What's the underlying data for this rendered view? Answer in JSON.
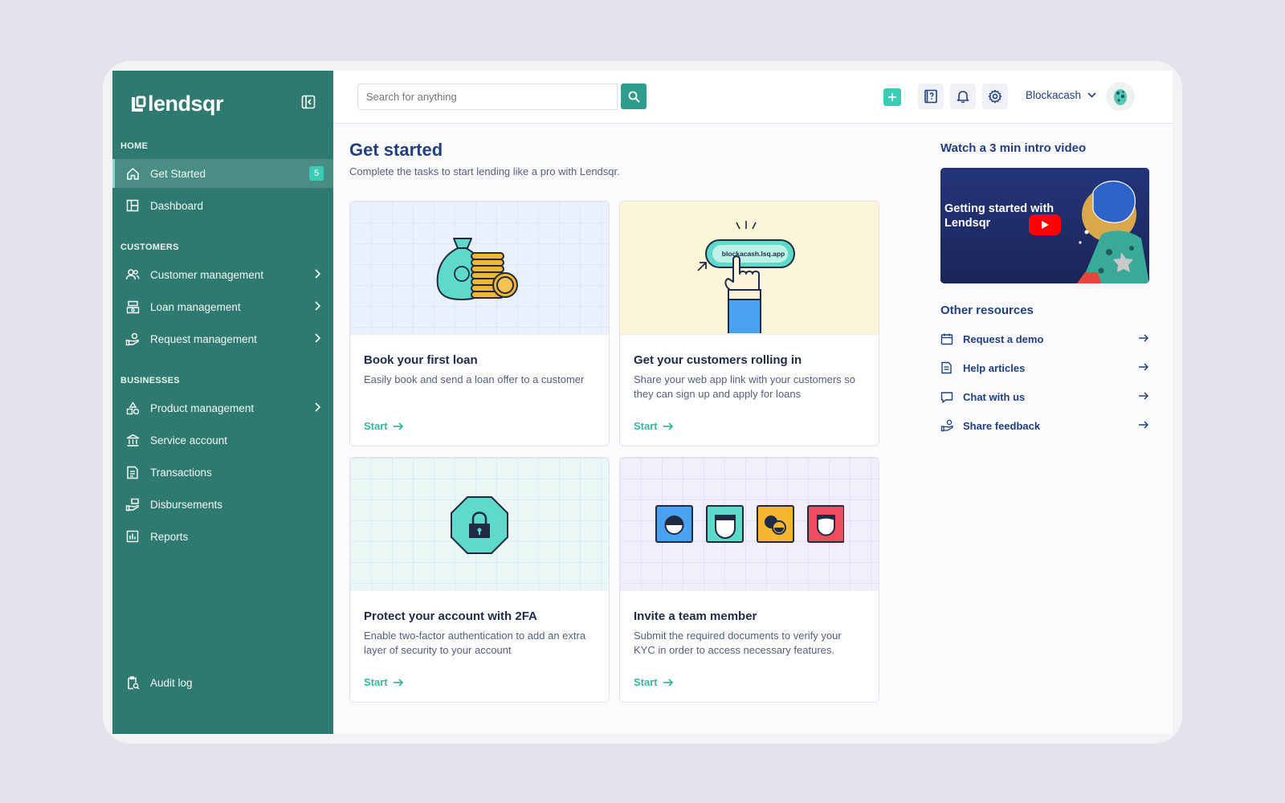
{
  "brand": {
    "name": "lendsqr"
  },
  "sidebar": {
    "sections": {
      "home": "HOME",
      "customers": "CUSTOMERS",
      "businesses": "BUSINESSES"
    },
    "items": {
      "get_started": {
        "label": "Get Started",
        "badge": "5"
      },
      "dashboard": {
        "label": "Dashboard"
      },
      "customer_management": {
        "label": "Customer management"
      },
      "loan_management": {
        "label": "Loan management"
      },
      "request_management": {
        "label": "Request management"
      },
      "product_management": {
        "label": "Product management"
      },
      "service_account": {
        "label": "Service account"
      },
      "transactions": {
        "label": "Transactions"
      },
      "disbursements": {
        "label": "Disbursements"
      },
      "reports": {
        "label": "Reports"
      },
      "audit_log": {
        "label": "Audit log"
      }
    }
  },
  "header": {
    "search_placeholder": "Search for anything",
    "user_name": "Blockacash"
  },
  "main": {
    "title": "Get started",
    "subtitle": "Complete the tasks to start lending like a pro with Lendsqr.",
    "cards": [
      {
        "title": "Book your first loan",
        "desc": "Easily book and send a loan offer to a customer",
        "cta": "Start"
      },
      {
        "title": "Get your customers rolling in",
        "desc": "Share your web app link with your customers so they can sign up and apply for loans",
        "cta": "Start",
        "url_pill": "blockacash.lsq.app"
      },
      {
        "title": "Protect your account with 2FA",
        "desc": "Enable two-factor authentication to add an extra layer of security to your account",
        "cta": "Start"
      },
      {
        "title": "Invite a team member",
        "desc": "Submit the required documents to verify your KYC in order to access necessary features.",
        "cta": "Start"
      }
    ]
  },
  "right": {
    "video_title": "Watch a 3 min intro video",
    "video_caption": "Getting started with Lendsqr",
    "resources_title": "Other resources",
    "resources": [
      {
        "label": "Request a demo"
      },
      {
        "label": "Help articles"
      },
      {
        "label": "Chat with us"
      },
      {
        "label": "Share feedback"
      }
    ]
  },
  "colors": {
    "sidebar": "#2f7a70",
    "accent": "#39cdb3",
    "navy": "#213f7d"
  }
}
